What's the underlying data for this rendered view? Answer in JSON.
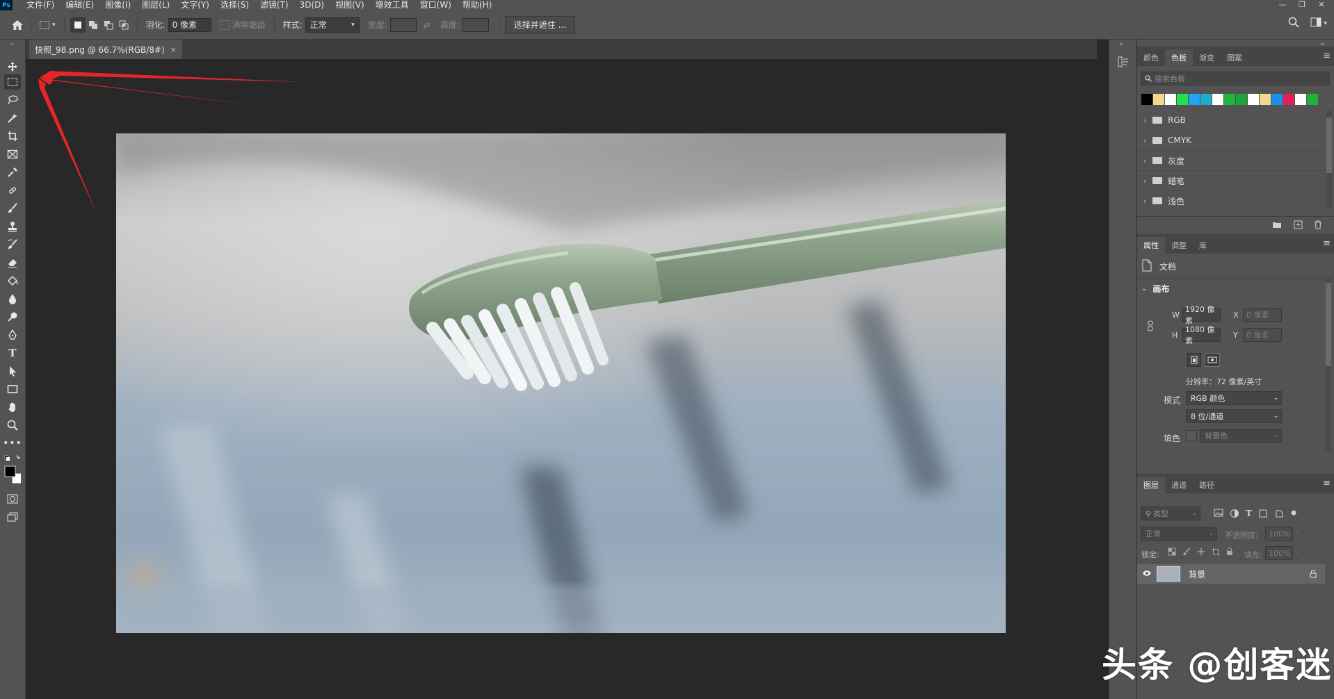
{
  "app": {
    "logo": "Ps"
  },
  "menu": [
    "文件(F)",
    "编辑(E)",
    "图像(I)",
    "图层(L)",
    "文字(Y)",
    "选择(S)",
    "滤镜(T)",
    "3D(D)",
    "视图(V)",
    "增效工具",
    "窗口(W)",
    "帮助(H)"
  ],
  "window_controls": {
    "minimize": "—",
    "restore": "❐",
    "close": "✕"
  },
  "options_bar": {
    "feather_label": "羽化:",
    "feather_value": "0 像素",
    "antialias_label": "消除锯齿",
    "style_label": "样式:",
    "style_value": "正常",
    "width_label": "宽度:",
    "height_label": "高度:",
    "select_mask_button": "选择并遮住 ..."
  },
  "document": {
    "tab_title": "快照_98.png @ 66.7%(RGB/8#)",
    "close": "×"
  },
  "swatches_panel": {
    "tabs": [
      "颜色",
      "色板",
      "渐变",
      "图案"
    ],
    "active_tab": "色板",
    "search_placeholder": "搜索色板",
    "colors": [
      "#000000",
      "#f5d78c",
      "#ffffff",
      "#22e14f",
      "#1fa6ee",
      "#22aacc",
      "#ffffff",
      "#1cb83a",
      "#1aa53a",
      "#ffffff",
      "#f2d98d",
      "#1a8ff0",
      "#e61e58",
      "#ffffff",
      "#19b23d"
    ],
    "groups": [
      "RGB",
      "CMYK",
      "灰度",
      "蜡笔",
      "浅色"
    ]
  },
  "properties_panel": {
    "tabs": [
      "属性",
      "调整",
      "库"
    ],
    "active_tab": "属性",
    "doc_label": "文档",
    "canvas_section": "画布",
    "w_label": "W",
    "w_value": "1920 像素",
    "h_label": "H",
    "h_value": "1080 像素",
    "x_label": "X",
    "x_placeholder": "0 像素",
    "y_label": "Y",
    "y_placeholder": "0 像素",
    "resolution": "分辨率：72 像素/英寸",
    "mode_label": "模式",
    "mode_value": "RGB 颜色",
    "depth_value": "8 位/通道",
    "fill_label": "填色",
    "fill_value": "背景色"
  },
  "layers_panel": {
    "tabs": [
      "图层",
      "通道",
      "路径"
    ],
    "active_tab": "图层",
    "filter_placeholder": "类型",
    "blend_mode": "正常",
    "opacity_label": "不透明度:",
    "opacity_value": "100%",
    "lock_label": "锁定:",
    "fill_label": "填充:",
    "fill_value": "100%",
    "layers": [
      {
        "name": "背景",
        "visible": true,
        "locked": true
      }
    ]
  },
  "watermark": "头条 @创客迷"
}
